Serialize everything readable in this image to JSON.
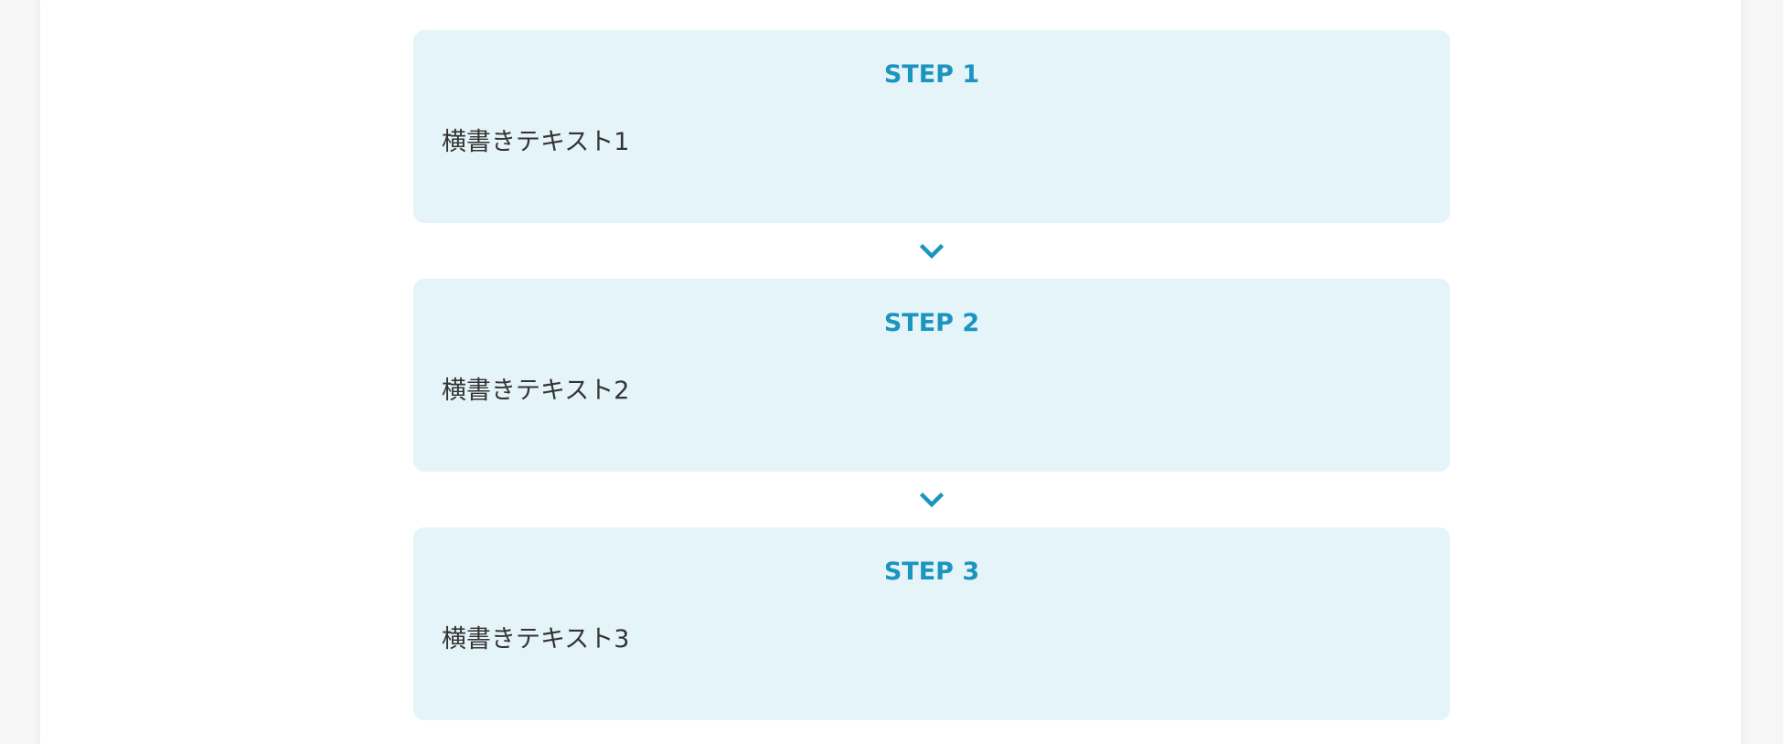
{
  "colors": {
    "step_background": "#e5f4f8",
    "step_title": "#1b95c0",
    "step_text": "#333333",
    "arrow": "#1b95c0"
  },
  "steps": [
    {
      "title": "STEP 1",
      "text": "横書きテキスト1"
    },
    {
      "title": "STEP 2",
      "text": "横書きテキスト2"
    },
    {
      "title": "STEP 3",
      "text": "横書きテキスト3"
    }
  ],
  "connector_icon": "chevron-down-icon"
}
